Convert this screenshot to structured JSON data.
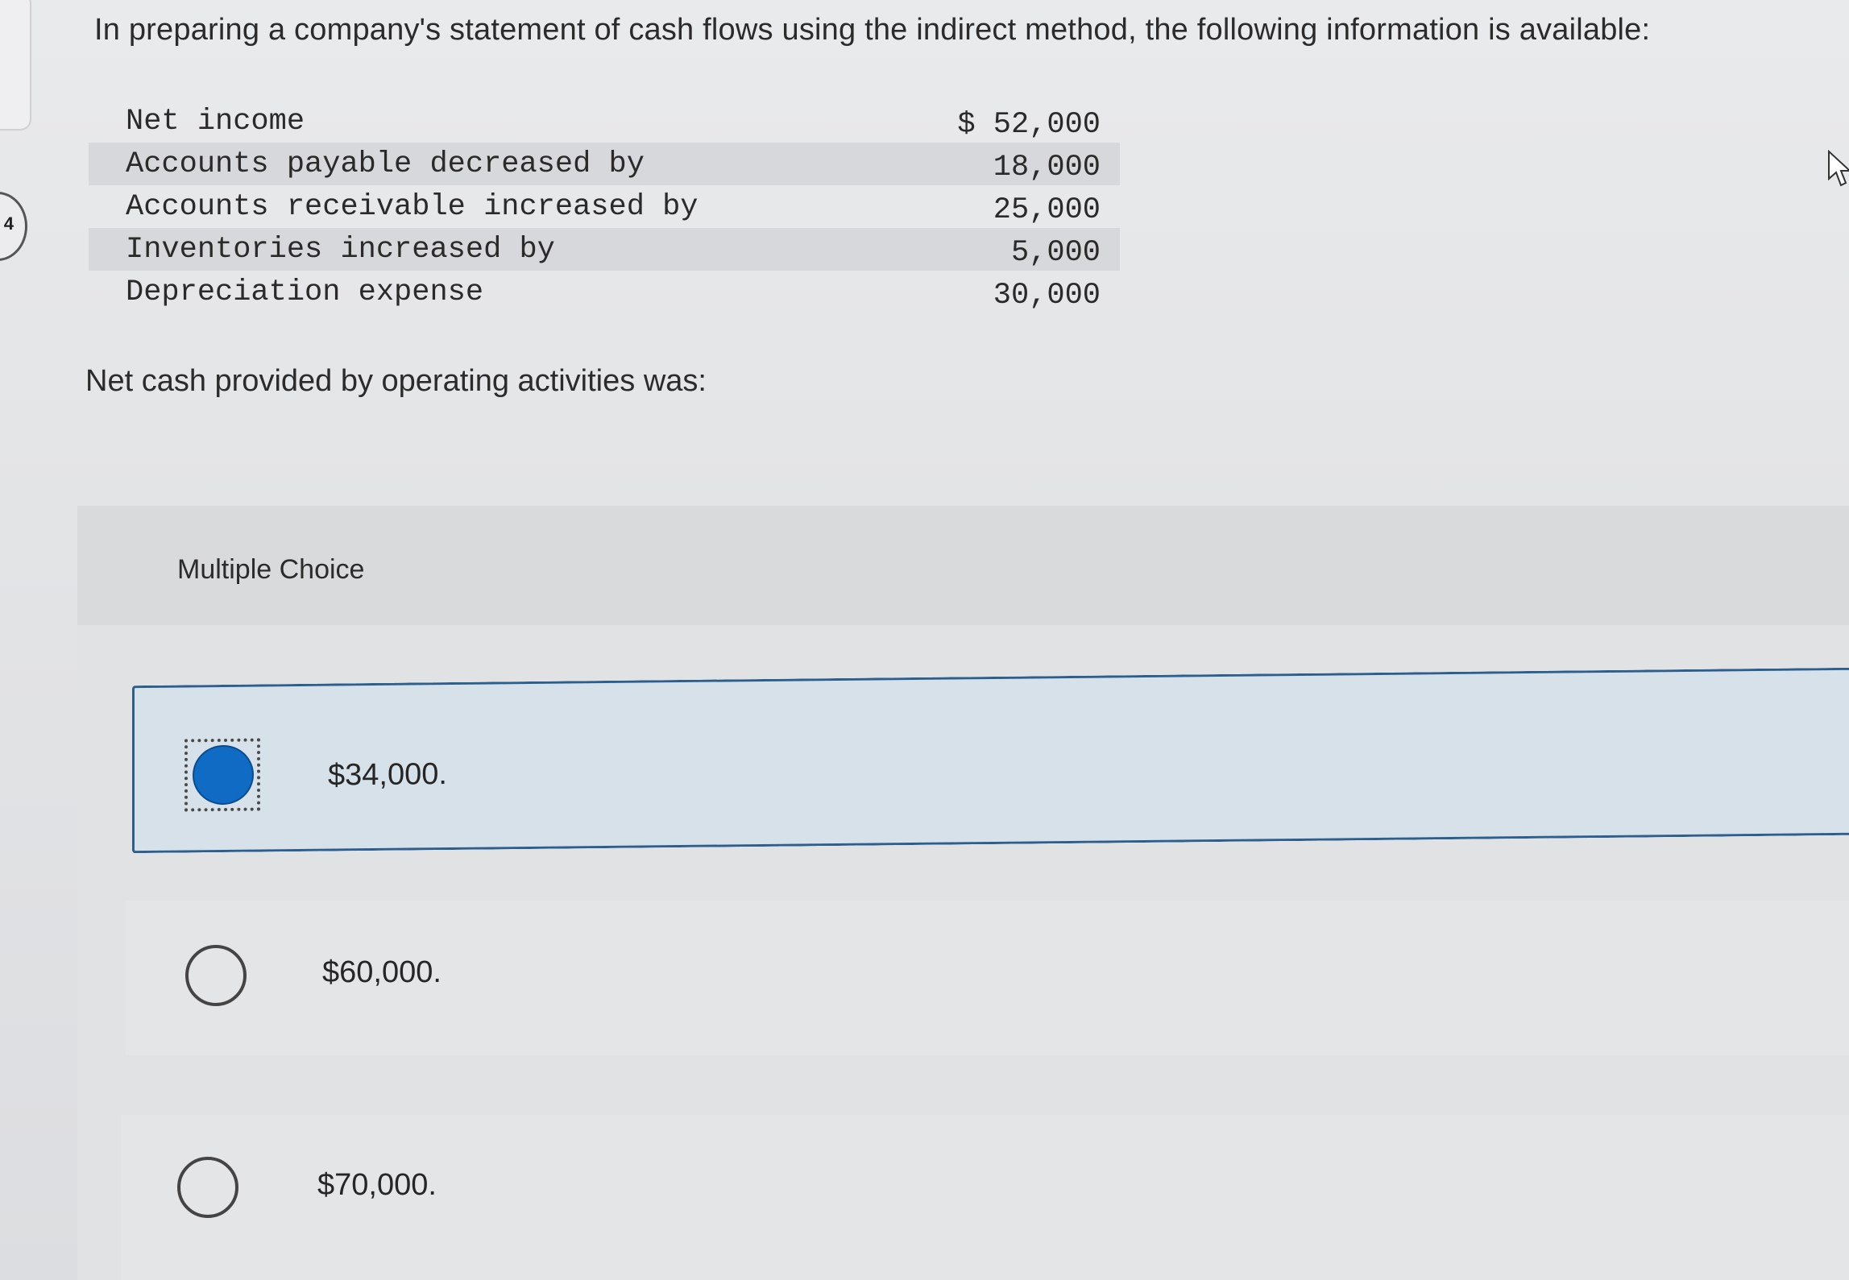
{
  "question": {
    "number": "4",
    "text": "In preparing a company's statement of cash flows using the indirect method, the following information is available:",
    "rows": [
      {
        "label": "Net income",
        "value": "$ 52,000"
      },
      {
        "label": "Accounts payable decreased by",
        "value": "18,000"
      },
      {
        "label": "Accounts receivable increased by",
        "value": "25,000"
      },
      {
        "label": "Inventories increased by",
        "value": "5,000"
      },
      {
        "label": "Depreciation expense",
        "value": "30,000"
      }
    ],
    "prompt": "Net cash provided by operating activities was:"
  },
  "multiple_choice": {
    "header": "Multiple Choice",
    "selected_index": 0,
    "options": [
      {
        "label": "$34,000."
      },
      {
        "label": "$60,000."
      },
      {
        "label": "$70,000."
      }
    ]
  },
  "colors": {
    "accent": "#0f6bc4",
    "selected_background": "#d6e1ea",
    "selected_border": "#2d5f8e"
  },
  "icons": {
    "cursor": "mouse-pointer-icon"
  }
}
